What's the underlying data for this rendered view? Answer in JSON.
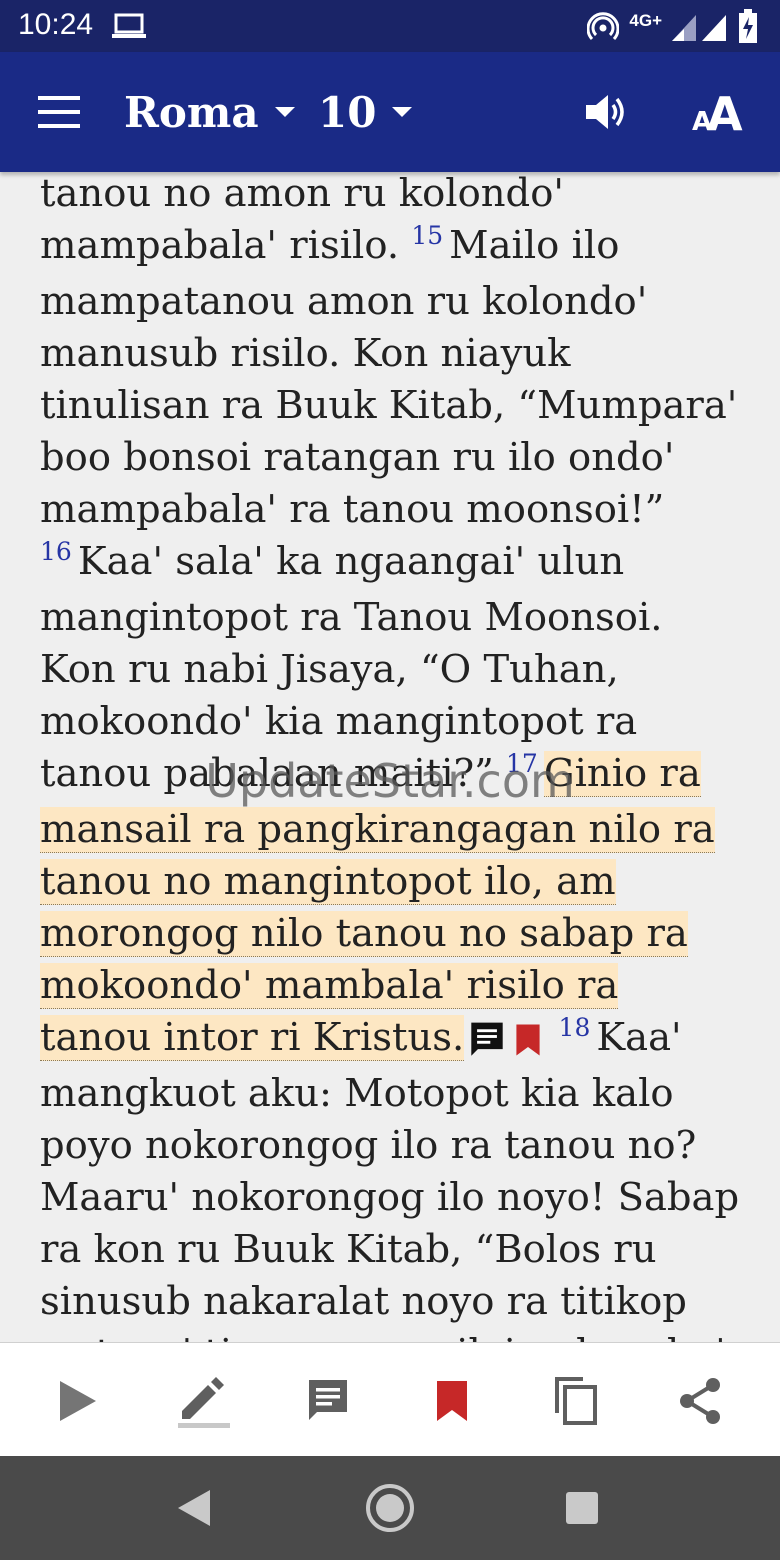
{
  "status_bar": {
    "time": "10:24",
    "network_label": "4G+",
    "icons": [
      "laptop-icon",
      "hotspot-icon",
      "signal-icon",
      "battery-charging-icon"
    ]
  },
  "app_bar": {
    "book": "Roma",
    "chapter": "10",
    "icons": [
      "menu-icon",
      "caret-down-icon",
      "speaker-icon",
      "font-size-icon"
    ],
    "color": "#1a2a86"
  },
  "reader": {
    "segments": [
      {
        "type": "text",
        "text": "tanou no amon ru kolondo' mampabala' risilo. "
      },
      {
        "type": "verse",
        "text": "15"
      },
      {
        "type": "text",
        "text": "Mailo ilo mampatanou amon ru kolondo' manusub risilo. Kon niayuk tinulisan ra Buuk Kitab, “Mumpara' boo bonsoi ratangan ru ilo ondo' mampabala' ra tanou moonsoi!” "
      },
      {
        "type": "verse",
        "text": "16"
      },
      {
        "type": "text",
        "text": "Kaa' sala' ka ngaangai' ulun mangintopot ra Tanou Moonsoi. Kon ru nabi Jisaya, “O Tuhan, mokoondo' kia mangintopot ra tanou pabalaan maiti?” "
      },
      {
        "type": "verse",
        "text": "17"
      },
      {
        "type": "highlight",
        "text": "Ginio ra mansail ra pangkirangagan nilo ra tanou no mangintopot ilo, am morongog nilo tanou no sabap ra mokoondo' mambala' risilo ra tanou intor ri Kristus."
      },
      {
        "type": "icons",
        "text": ""
      },
      {
        "type": "text",
        "text": " "
      },
      {
        "type": "verse",
        "text": "18"
      },
      {
        "type": "text",
        "text": "Kaa' mangkuot aku: Motopot kia kalo poyo nokorongog ilo ra tanou no? Maaru' nokorongog ilo noyo! Sabap ra kon ru Buuk Kitab, “Bolos ru sinusub nakaralat noyo ra titikop ru tana' ti, am ragu nilai nakasuku'"
      }
    ],
    "highlight_color": "#fde7c3",
    "verse_number_color": "#2635a5",
    "inline_icons": [
      "note-icon",
      "bookmark-icon"
    ]
  },
  "watermark": "UpdateStar.com",
  "bottom_toolbar": {
    "buttons": [
      "play-icon",
      "highlight-pen-icon",
      "note-icon",
      "bookmark-icon",
      "copy-icon",
      "share-icon"
    ],
    "bookmark_color": "#c62828"
  },
  "nav_bar": {
    "buttons": [
      "back-icon",
      "home-icon",
      "recents-icon"
    ]
  }
}
